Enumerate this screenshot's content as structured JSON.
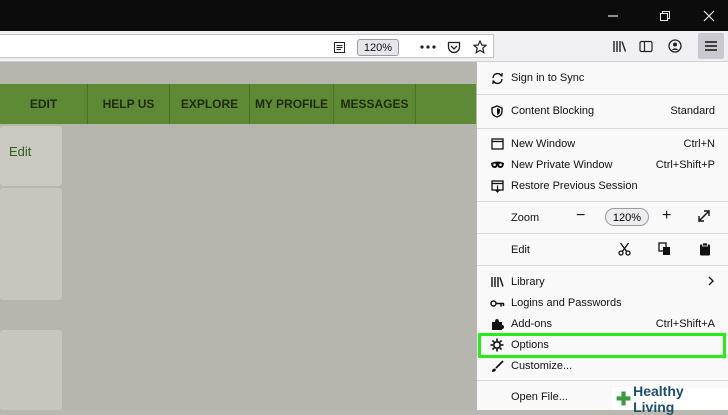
{
  "window": {
    "minimize_icon": "minimize-icon",
    "restore_icon": "restore-icon",
    "close_icon": "close-icon"
  },
  "toolbar": {
    "zoom_level": "120%",
    "icons": [
      "reader-view-icon",
      "more-icon",
      "pocket-icon",
      "bookmark-star-icon",
      "library-icon",
      "sidebar-icon",
      "account-icon",
      "hamburger-menu-icon"
    ]
  },
  "site_nav": {
    "items": [
      "EDIT",
      "HELP US",
      "EXPLORE",
      "MY PROFILE",
      "MESSAGES"
    ],
    "color": "#5f8a35"
  },
  "page": {
    "edit_link": "Edit"
  },
  "menu": {
    "sign_in": "Sign in to Sync",
    "content_blocking": {
      "label": "Content Blocking",
      "value": "Standard"
    },
    "new_window": {
      "label": "New Window",
      "shortcut": "Ctrl+N"
    },
    "new_private_window": {
      "label": "New Private Window",
      "shortcut": "Ctrl+Shift+P"
    },
    "restore_session": "Restore Previous Session",
    "zoom": {
      "label": "Zoom",
      "minus": "−",
      "value": "120%",
      "plus": "+"
    },
    "edit": {
      "label": "Edit"
    },
    "library": "Library",
    "logins": "Logins and Passwords",
    "addons": {
      "label": "Add-ons",
      "shortcut": "Ctrl+Shift+A"
    },
    "options": "Options",
    "customize": "Customize...",
    "open_file": "Open File..."
  },
  "highlight_color": "#26ee14",
  "watermark": {
    "text": "Healthy Living"
  }
}
